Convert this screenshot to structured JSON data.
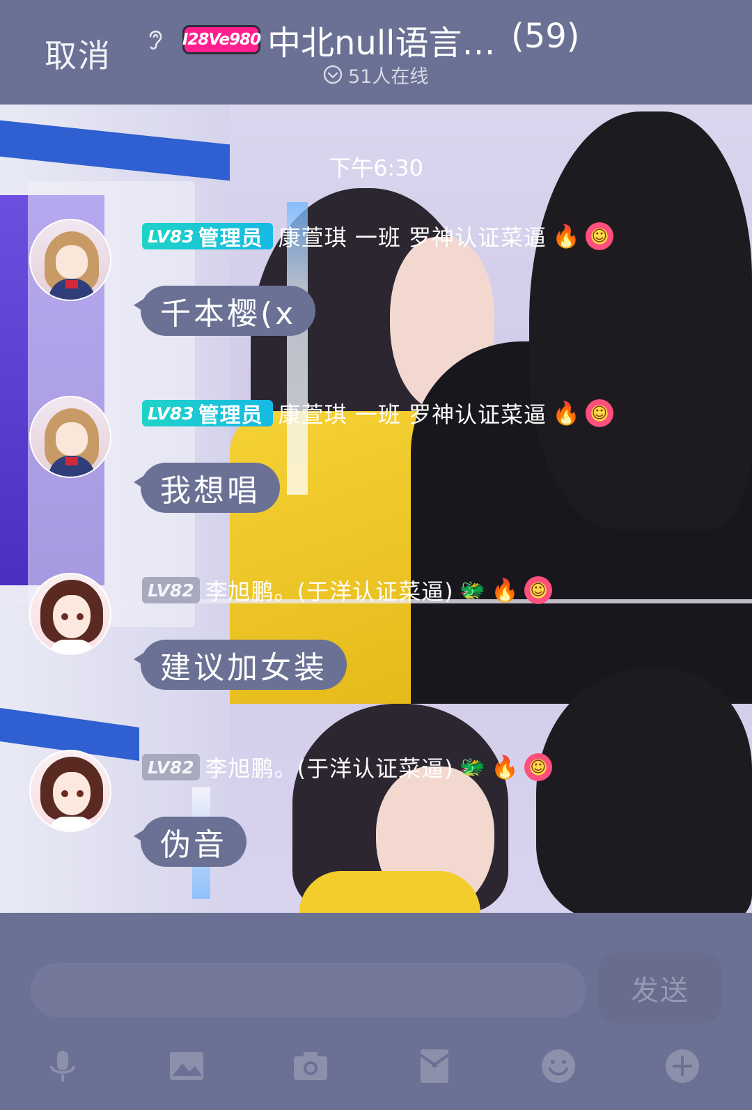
{
  "header": {
    "cancel_label": "取消",
    "brand_badge_text": "I28Ve980",
    "group_title": "中北null语言…",
    "member_count": "(59)",
    "online_text": "51人在线"
  },
  "chat": {
    "timestamp": "下午6:30",
    "messages": [
      {
        "level": "LV83",
        "role": "管理员",
        "nickname": "康萱琪 一班 罗神认证菜逼",
        "text": "千本樱(x"
      },
      {
        "level": "LV83",
        "role": "管理员",
        "nickname": "康萱琪 一班 罗神认证菜逼",
        "text": "我想唱"
      },
      {
        "level": "LV82",
        "nickname": "李旭鹏。(于洋认证菜逼)",
        "text": "建议加女装"
      },
      {
        "level": "LV82",
        "nickname": "李旭鹏。(于洋认证菜逼)",
        "text": "伪音"
      }
    ]
  },
  "input": {
    "placeholder": "",
    "send_label": "发送"
  },
  "icons": [
    "ear-icon",
    "online-check-icon",
    "fire-icon",
    "smile-flower-icon",
    "dragon-icon",
    "microphone-icon",
    "image-icon",
    "camera-icon",
    "red-packet-icon",
    "emoji-icon",
    "plus-icon"
  ],
  "colors": {
    "theme_bg": "#6b7194",
    "admin_badge": "#1fd3c8",
    "level_badge": "#a9a9bd",
    "bubble_bg": "#6b7194"
  }
}
